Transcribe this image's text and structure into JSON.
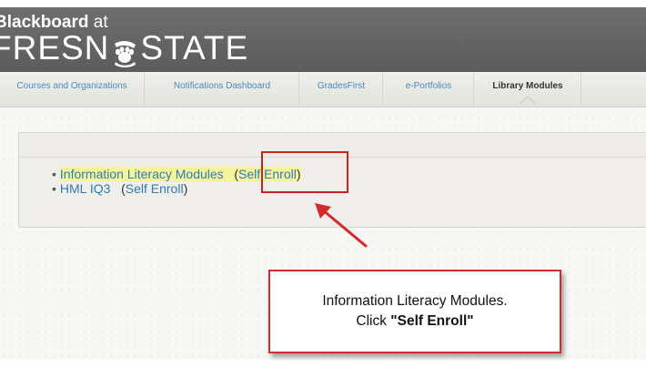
{
  "brand": {
    "line1_bold": "Blackboard",
    "line1_rest": " at",
    "line2_part1": "FRESN",
    "line2_part2": "STATE",
    "logo_icon": "paw-print-icon"
  },
  "tabs": [
    {
      "label": "Courses and Organizations"
    },
    {
      "label": "Notifications Dashboard"
    },
    {
      "label": "GradesFirst"
    },
    {
      "label": "e-Portfolios"
    },
    {
      "label": "Library Modules",
      "active": true
    }
  ],
  "modules": [
    {
      "bullet": "•",
      "title": "Information Literacy Modules",
      "enroll": "Self Enroll",
      "highlighted": true
    },
    {
      "bullet": "•",
      "title": "HML IQ3",
      "enroll": "Self Enroll",
      "highlighted": false
    }
  ],
  "callout": {
    "line1": "Information Literacy Modules.",
    "line2_prefix": "Click ",
    "line2_bold": "\"Self Enroll\""
  },
  "colors": {
    "header_bg": "#666666",
    "link": "#2d7bb8",
    "highlight": "#f6f49a",
    "annotation_red": "#d22b2b"
  }
}
